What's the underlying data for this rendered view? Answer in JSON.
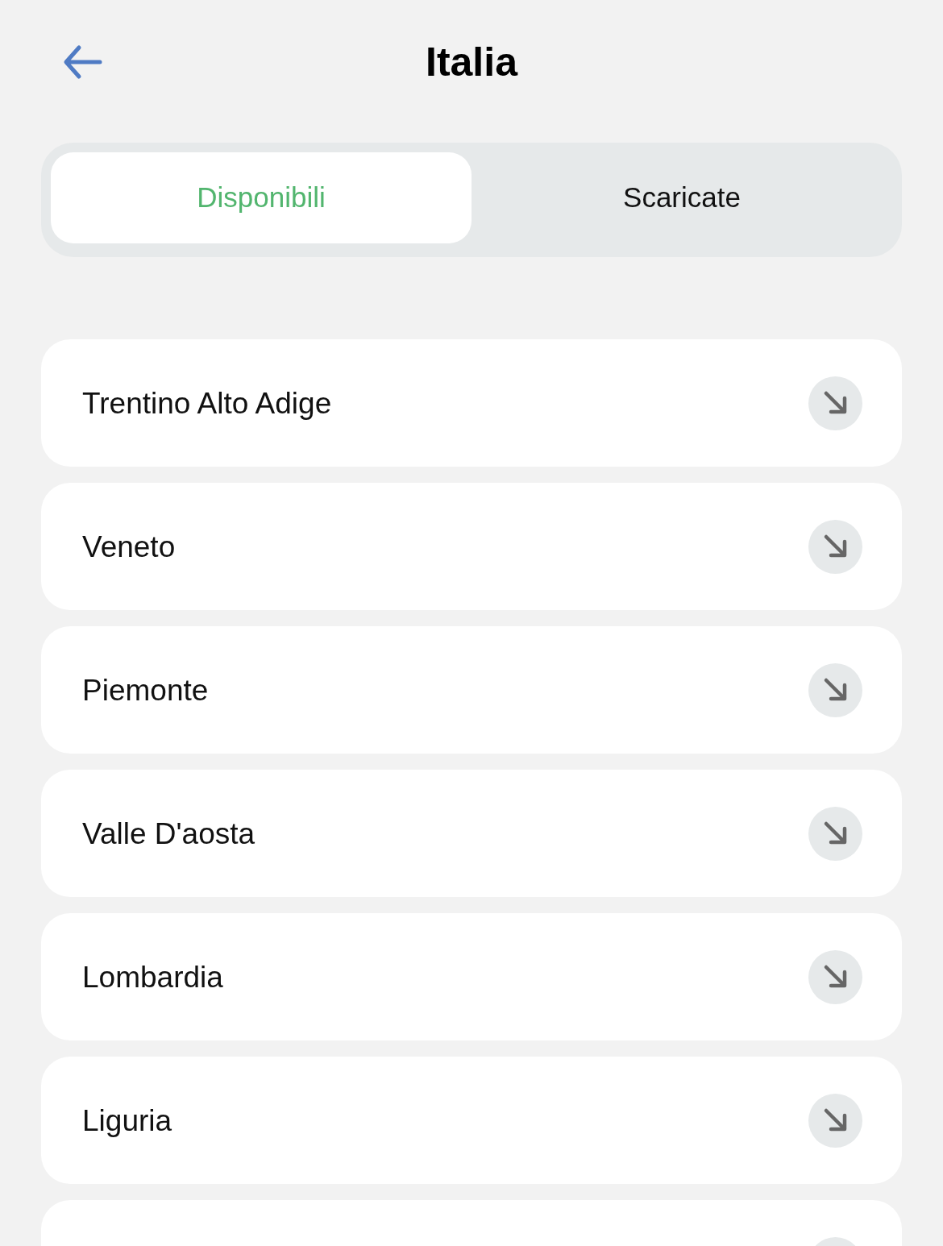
{
  "header": {
    "title": "Italia"
  },
  "tabs": [
    {
      "label": "Disponibili",
      "selected": true
    },
    {
      "label": "Scaricate",
      "selected": false
    }
  ],
  "regions": [
    {
      "kind": "row",
      "name": "Trentino Alto Adige"
    },
    {
      "kind": "row",
      "name": "Veneto"
    },
    {
      "kind": "row",
      "name": "Piemonte"
    },
    {
      "kind": "row",
      "name": "Valle D'aosta"
    },
    {
      "kind": "row",
      "name": "Lombardia"
    },
    {
      "kind": "row",
      "name": "Liguria"
    },
    {
      "kind": "cut"
    }
  ]
}
